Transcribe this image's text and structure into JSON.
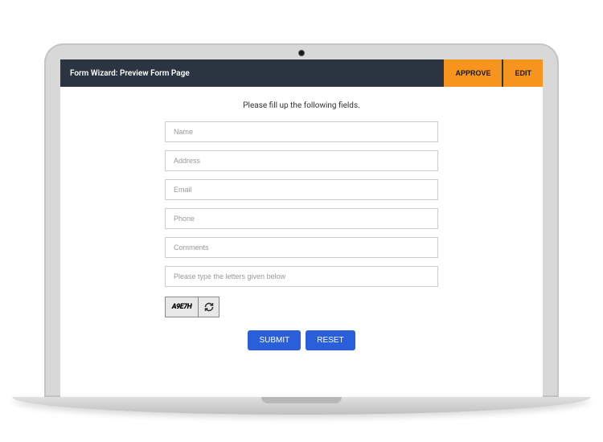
{
  "header": {
    "title": "Form Wizard: Preview Form Page",
    "approve_label": "APPROVE",
    "edit_label": "EDIT"
  },
  "form": {
    "instruction": "Please fill up the following fields.",
    "fields": {
      "name_placeholder": "Name",
      "address_placeholder": "Address",
      "email_placeholder": "Email",
      "phone_placeholder": "Phone",
      "comments_placeholder": "Comments",
      "captcha_placeholder": "Please type the letters given below"
    },
    "captcha_text": "A9E7H",
    "submit_label": "SUBMIT",
    "reset_label": "RESET"
  }
}
